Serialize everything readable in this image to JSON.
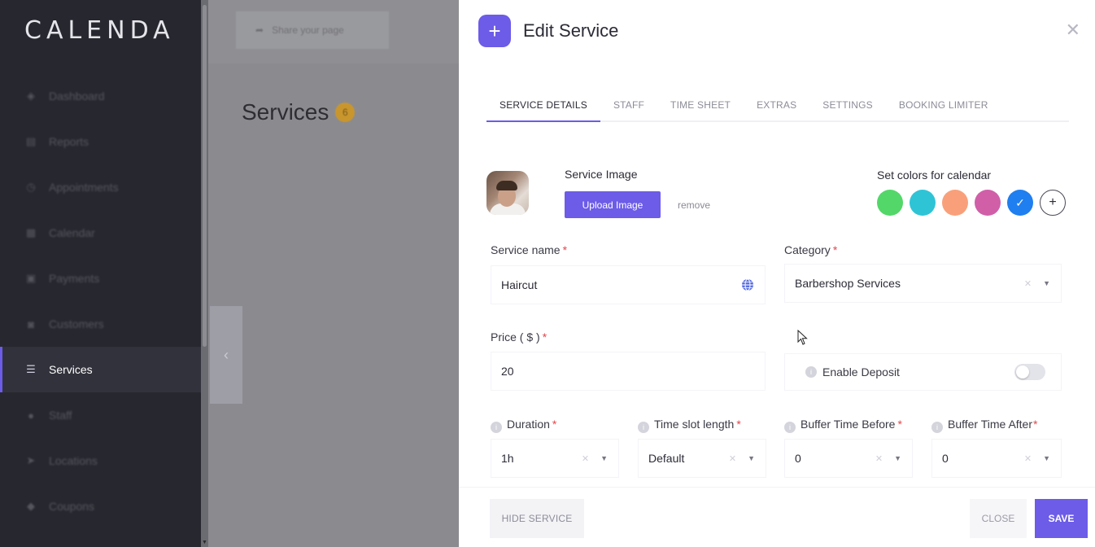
{
  "sidebar": {
    "logo": "CALENDA",
    "items": [
      {
        "label": "Dashboard",
        "icon": "cube-icon"
      },
      {
        "label": "Reports",
        "icon": "chart-icon"
      },
      {
        "label": "Appointments",
        "icon": "clock-icon"
      },
      {
        "label": "Calendar",
        "icon": "calendar-icon"
      },
      {
        "label": "Payments",
        "icon": "payments-icon"
      },
      {
        "label": "Customers",
        "icon": "customers-icon"
      },
      {
        "label": "Services",
        "icon": "services-icon",
        "active": true
      },
      {
        "label": "Staff",
        "icon": "staff-icon"
      },
      {
        "label": "Locations",
        "icon": "location-icon"
      },
      {
        "label": "Coupons",
        "icon": "coupon-icon"
      }
    ]
  },
  "main": {
    "share_label": "Share your page",
    "page_title": "Services",
    "services_count": "6"
  },
  "drawer": {
    "title": "Edit Service",
    "tabs": [
      {
        "label": "SERVICE DETAILS",
        "active": true
      },
      {
        "label": "STAFF"
      },
      {
        "label": "TIME SHEET"
      },
      {
        "label": "EXTRAS"
      },
      {
        "label": "SETTINGS"
      },
      {
        "label": "BOOKING LIMITER"
      }
    ],
    "image": {
      "label": "Service Image",
      "upload_label": "Upload Image",
      "remove_label": "remove"
    },
    "calendar_colors": {
      "label": "Set colors for calendar",
      "swatches": [
        "#53d769",
        "#2ec4d6",
        "#f9a07a",
        "#d05fa8",
        "#1f7ef0"
      ],
      "selected_index": 4
    },
    "fields": {
      "service_name": {
        "label": "Service name",
        "value": "Haircut"
      },
      "category": {
        "label": "Category",
        "value": "Barbershop Services"
      },
      "price": {
        "label": "Price ( $ )",
        "value": "20"
      },
      "enable_deposit": {
        "label": "Enable Deposit",
        "enabled": false
      },
      "duration": {
        "label": "Duration",
        "value": "1h"
      },
      "time_slot_length": {
        "label": "Time slot length",
        "value": "Default"
      },
      "buffer_before": {
        "label": "Buffer Time Before",
        "value": "0"
      },
      "buffer_after": {
        "label": "Buffer Time After",
        "value": "0"
      }
    },
    "footer": {
      "hide_label": "HIDE SERVICE",
      "close_label": "CLOSE",
      "save_label": "SAVE"
    }
  },
  "colors": {
    "accent": "#6c5ce7",
    "sidebar_bg": "#27272f",
    "required": "#e0474c"
  }
}
